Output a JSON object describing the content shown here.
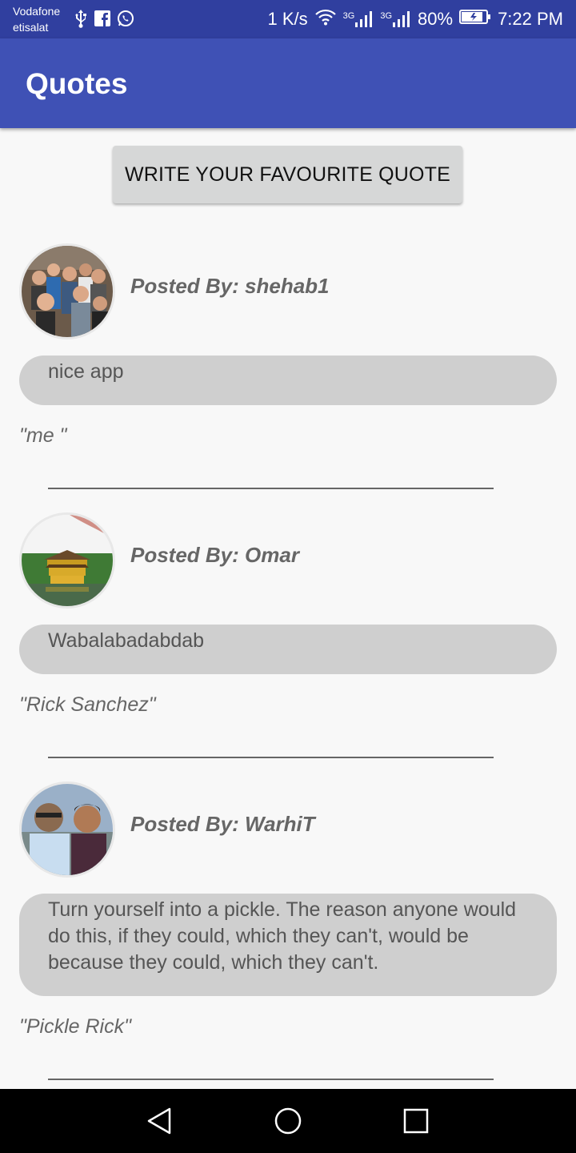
{
  "status_bar": {
    "carrier_line1": "Vodafone",
    "carrier_line2": "etisalat",
    "speed": "1 K/s",
    "net1": "3G",
    "net2": "3G",
    "battery": "80%",
    "time": "7:22 PM",
    "icons": [
      "usb-icon",
      "facebook-icon",
      "whatsapp-icon",
      "wifi-icon",
      "signal-icon",
      "signal-icon",
      "battery-icon"
    ]
  },
  "app_bar": {
    "title": "Quotes"
  },
  "write_button": {
    "label": "WRITE YOUR FAVOURITE QUOTE"
  },
  "posts": [
    {
      "posted_by": "Posted By: shehab1",
      "quote": "nice app",
      "author": "\"me  \"",
      "avatar": "group-selfie-photo"
    },
    {
      "posted_by": "Posted By: Omar",
      "quote": "Wabalabadabdab",
      "author": "\"Rick Sanchez\"",
      "avatar": "golden-pavilion-photo"
    },
    {
      "posted_by": "Posted By: WarhiT",
      "quote": "Turn yourself into a pickle. The reason anyone would do this, if they could, which they can't, would be because they could, which they can't.",
      "author": "\"Pickle Rick\"",
      "avatar": "two-friends-selfie-photo"
    }
  ],
  "nav_bar": {
    "icons": [
      "back-icon",
      "home-icon",
      "recents-icon"
    ]
  }
}
